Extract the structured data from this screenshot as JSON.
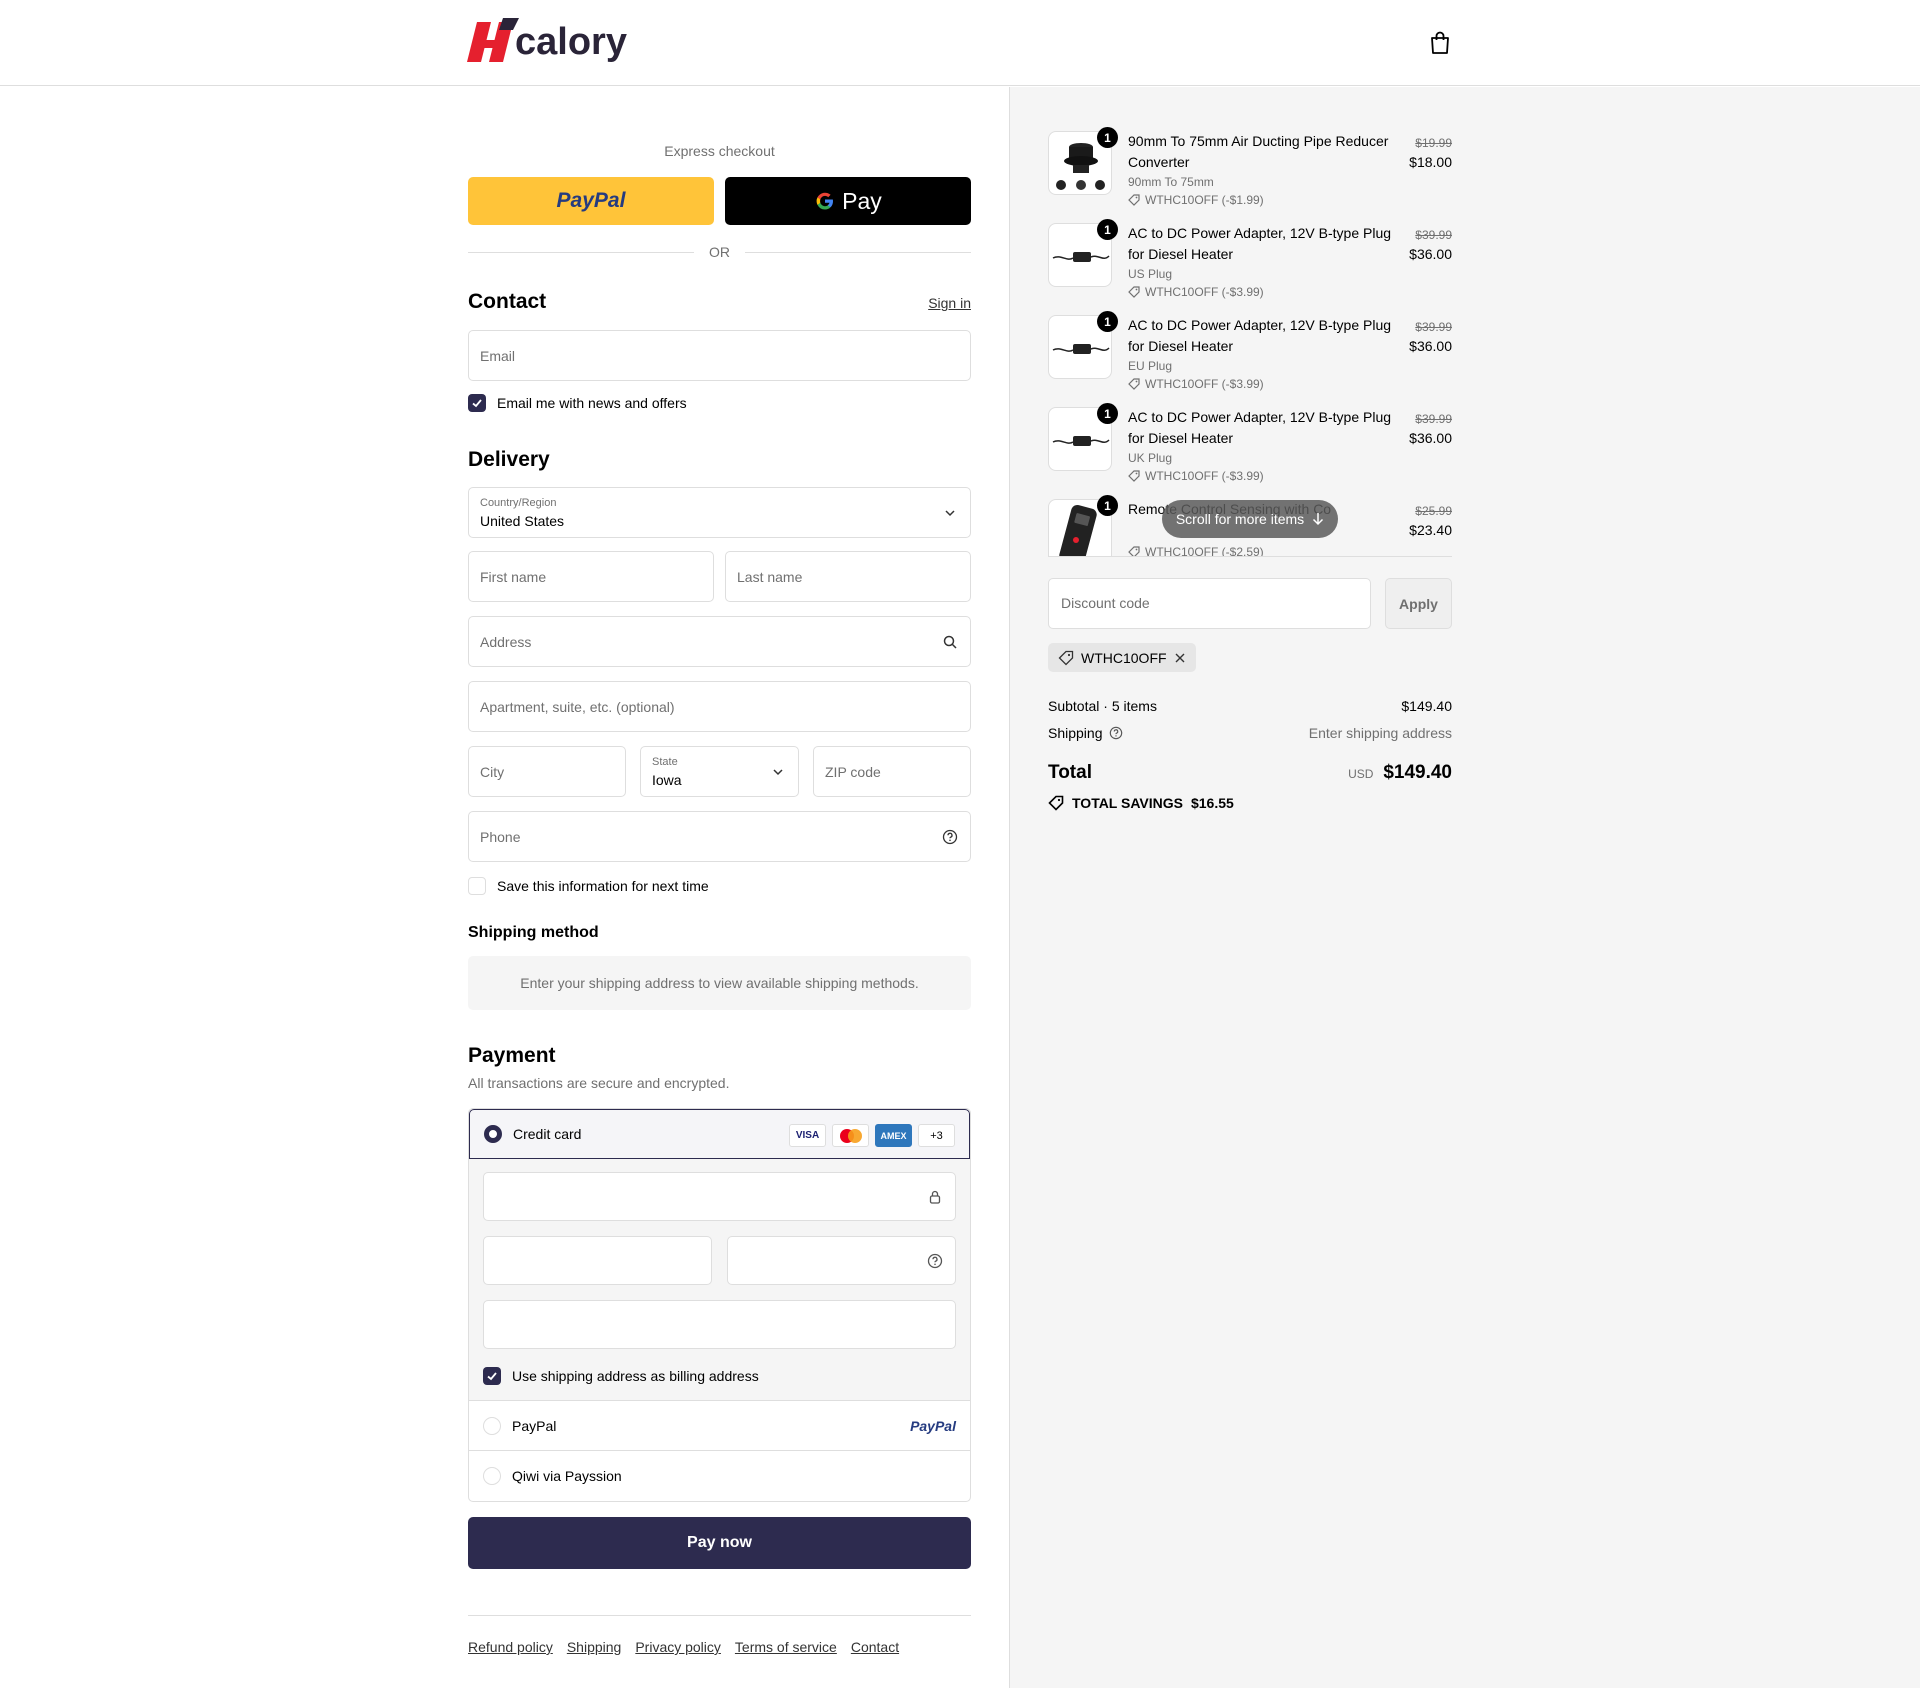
{
  "brand": {
    "name": "calory"
  },
  "express": {
    "label": "Express checkout",
    "paypal_label": "PayPal",
    "gpay_label": "Pay",
    "or_label": "OR"
  },
  "contact": {
    "title": "Contact",
    "sign_in": "Sign in",
    "email_placeholder": "Email",
    "news_label": "Email me with news and offers"
  },
  "delivery": {
    "title": "Delivery",
    "country_label": "Country/Region",
    "country_value": "United States",
    "first_name": "First name",
    "last_name": "Last name",
    "address": "Address",
    "apartment": "Apartment, suite, etc. (optional)",
    "city": "City",
    "state_label": "State",
    "state_value": "Iowa",
    "zip": "ZIP code",
    "phone": "Phone",
    "save_info": "Save this information for next time"
  },
  "shipping_method": {
    "title": "Shipping method",
    "note": "Enter your shipping address to view available shipping methods."
  },
  "payment": {
    "title": "Payment",
    "subtitle": "All transactions are secure and encrypted.",
    "credit_card": "Credit card",
    "card_logos": [
      "VISA",
      "",
      "AMEX",
      "+3"
    ],
    "billing_same": "Use shipping address as billing address",
    "paypal": "PayPal",
    "paypal_logo": "PayPal",
    "qiwi": "Qiwi via Payssion",
    "pay_now": "Pay now"
  },
  "footer": {
    "links": [
      "Refund policy",
      "Shipping",
      "Privacy policy",
      "Terms of service",
      "Contact"
    ]
  },
  "summary": {
    "items": [
      {
        "qty": "1",
        "name": "90mm To 75mm Air Ducting Pipe Reducer Converter",
        "variant": "90mm To 75mm",
        "discount": "WTHC10OFF (-$1.99)",
        "old_price": "$19.99",
        "price": "$18.00"
      },
      {
        "qty": "1",
        "name": "AC to DC Power Adapter, 12V B-type Plug for Diesel Heater",
        "variant": "US Plug",
        "discount": "WTHC10OFF (-$3.99)",
        "old_price": "$39.99",
        "price": "$36.00"
      },
      {
        "qty": "1",
        "name": "AC to DC Power Adapter, 12V B-type Plug for Diesel Heater",
        "variant": "EU Plug",
        "discount": "WTHC10OFF (-$3.99)",
        "old_price": "$39.99",
        "price": "$36.00"
      },
      {
        "qty": "1",
        "name": "AC to DC Power Adapter, 12V B-type Plug for Diesel Heater",
        "variant": "UK Plug",
        "discount": "WTHC10OFF (-$3.99)",
        "old_price": "$39.99",
        "price": "$36.00"
      },
      {
        "qty": "1",
        "name": "Remote Control Sensing with Co",
        "variant": "",
        "discount": "WTHC10OFF (-$2.59)",
        "old_price": "$25.99",
        "price": "$23.40"
      }
    ],
    "scroll_hint": "Scroll for more items",
    "discount_placeholder": "Discount code",
    "apply": "Apply",
    "applied_code": "WTHC10OFF",
    "subtotal_label": "Subtotal · 5 items",
    "subtotal_value": "$149.40",
    "shipping_label": "Shipping",
    "shipping_value": "Enter shipping address",
    "total_label": "Total",
    "currency": "USD",
    "total_value": "$149.40",
    "savings_label": "TOTAL SAVINGS",
    "savings_value": "$16.55"
  }
}
